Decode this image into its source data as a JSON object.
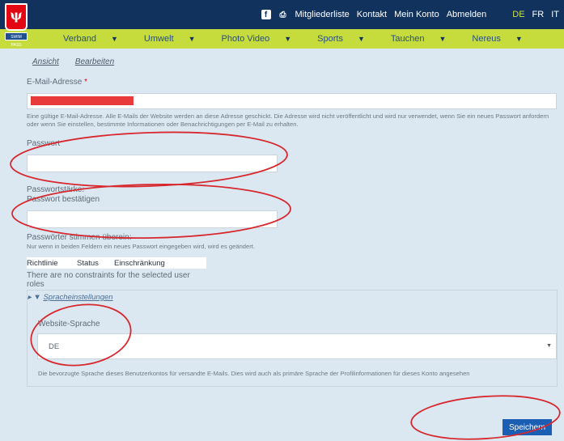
{
  "header": {
    "links": [
      "Mitgliederliste",
      "Kontakt",
      "Mein Konto",
      "Abmelden"
    ],
    "languages": [
      "DE",
      "FR",
      "IT"
    ],
    "logo_text": "ψ",
    "logo_ribbon": "SWIM PASS"
  },
  "menu": {
    "items": [
      "Verband",
      "Umwelt",
      "Photo Video",
      "Sports",
      "Tauchen",
      "Nereus"
    ]
  },
  "tabs": {
    "view": "Ansicht",
    "edit": "Bearbeiten"
  },
  "email": {
    "label": "E-Mail-Adresse",
    "required_mark": "*",
    "help": "Eine gültige E-Mail-Adresse. Alle E-Mails der Website werden an diese Adresse geschickt. Die Adresse wird nicht veröffentlicht und wird nur verwendet, wenn Sie ein neues Passwort anfordern oder wenn Sie einstellen, bestimmte Informationen oder Benachrichtigungen per E-Mail zu erhalten."
  },
  "password": {
    "label": "Passwort",
    "strength": "Passwortstärke:",
    "confirm_label": "Passwort bestätigen",
    "match": "Passwörter stimmen überein:",
    "help": "Nur wenn in beiden Feldern ein neues Passwort eingegeben wird, wird es geändert."
  },
  "constraints": {
    "headers": [
      "Richtlinie",
      "Status",
      "Einschränkung"
    ],
    "empty": "There are no constraints for the selected user roles"
  },
  "language_settings": {
    "toggle": "▸ ▼",
    "title": "Spracheinstellungen",
    "label": "Website-Sprache",
    "value": "DE",
    "help": "Die bevorzugte Sprache dieses Benutzerkontos für versandte E-Mails. Dies wird auch als primäre Sprache der Profilinformationen für dieses Konto angesehen"
  },
  "actions": {
    "save": "Speichern"
  },
  "colors": {
    "topbar": "#12325e",
    "menubar": "#c5dc3c",
    "background": "#dbe8f1",
    "button": "#1a5fb4",
    "annotation": "#d8282f"
  }
}
